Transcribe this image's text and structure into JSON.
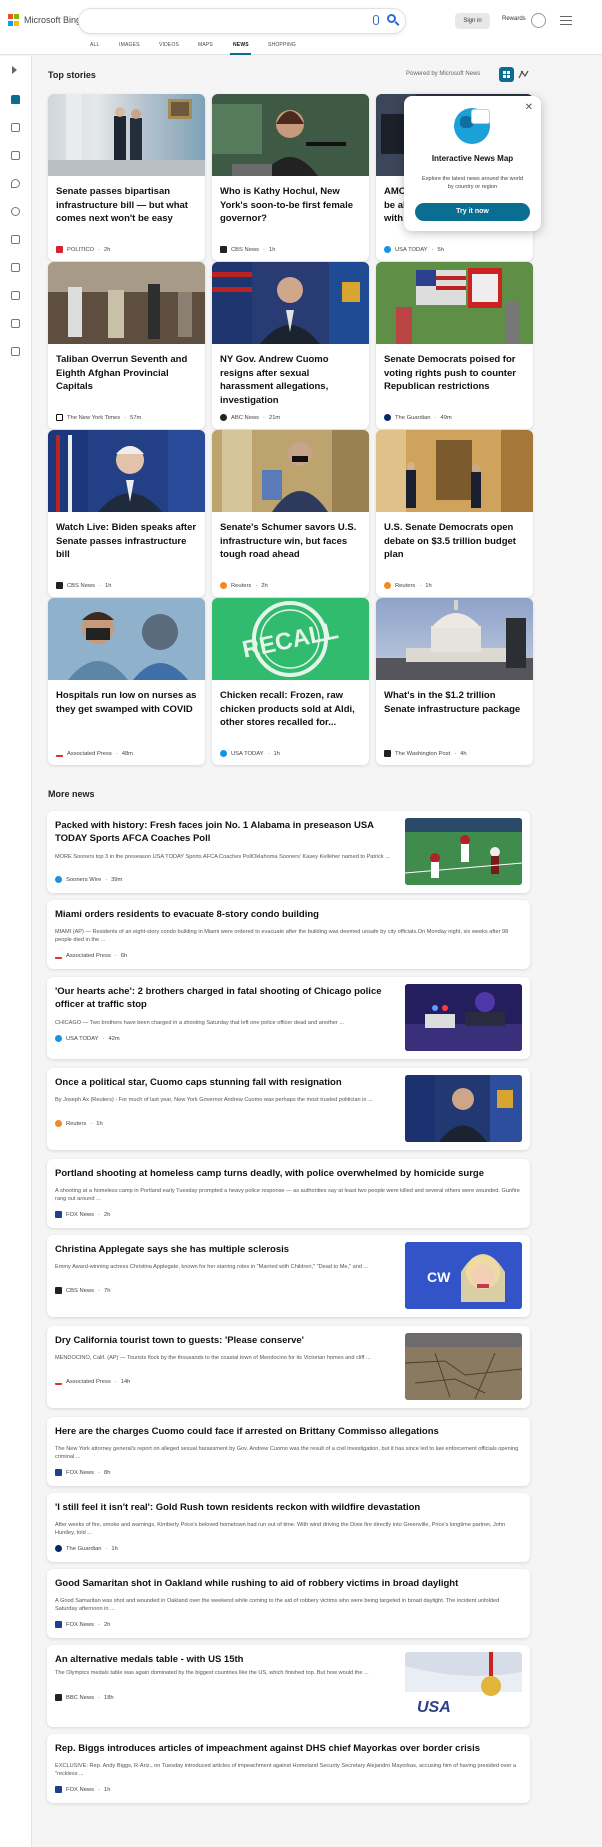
{
  "header": {
    "logo_text": "Microsoft Bing",
    "sign_in": "Sign in",
    "rewards": "Rewards",
    "tabs": [
      "ALL",
      "IMAGES",
      "VIDEOS",
      "MAPS",
      "NEWS",
      "SHOPPING"
    ],
    "active_tab": "NEWS"
  },
  "top_stories": {
    "heading": "Top stories",
    "powered_by": "Powered by Microsoft News",
    "cards": [
      {
        "title": "Senate passes bipartisan infrastructure bill — but what comes next won't be easy",
        "source": "POLITICO",
        "time": "2h",
        "source_color": "#d6232f"
      },
      {
        "title": "Who is Kathy Hochul, New York's soon-to-be first female governor?",
        "source": "CBS News",
        "time": "1h",
        "source_color": "#222222"
      },
      {
        "title": "AMC be al with",
        "source": "USA TODAY",
        "time": "5h",
        "source_color": "#1a90e8"
      },
      {
        "title": "Taliban Overrun Seventh and Eighth Afghan Provincial Capitals",
        "source": "The New York Times",
        "time": "57m",
        "source_color": "#111111"
      },
      {
        "title": "NY Gov. Andrew Cuomo resigns after sexual harassment allegations, investigation",
        "source": "ABC News",
        "time": "21m",
        "source_color": "#222222"
      },
      {
        "title": "Senate Democrats poised for voting rights push to counter Republican restrictions",
        "source": "The Guardian",
        "time": "49m",
        "source_color": "#052962"
      },
      {
        "title": "Watch Live: Biden speaks after Senate passes infrastructure bill",
        "source": "CBS News",
        "time": "1h",
        "source_color": "#222222"
      },
      {
        "title": "Senate's Schumer savors U.S. infrastructure win, but faces tough road ahead",
        "source": "Reuters",
        "time": "2h",
        "source_color": "#f08a24"
      },
      {
        "title": "U.S. Senate Democrats open debate on $3.5 trillion budget plan",
        "source": "Reuters",
        "time": "1h",
        "source_color": "#f08a24"
      },
      {
        "title": "Hospitals run low on nurses as they get swamped with COVID",
        "source": "Associated Press",
        "time": "48m",
        "source_color": "#e4312b"
      },
      {
        "title": "Chicken recall: Frozen, raw chicken products sold at Aldi, other stores recalled for...",
        "source": "USA TODAY",
        "time": "1h",
        "source_color": "#1a90e8"
      },
      {
        "title": "What's in the $1.2 trillion Senate infrastructure package",
        "source": "The Washington Post",
        "time": "4h",
        "source_color": "#222222"
      }
    ]
  },
  "popup": {
    "title": "Interactive News Map",
    "description": "Explore the latest news around the world by country or region",
    "button": "Try it now",
    "close": "✕"
  },
  "recall_image_text": "RECALL",
  "more_news": {
    "heading": "More news",
    "items": [
      {
        "title": "Packed with history: Fresh faces join No. 1 Alabama in preseason USA TODAY Sports AFCA Coaches Poll",
        "desc": "MORE Sooners top 3 in the preseason USA TODAY Sports AFCA Coaches PollOklahoma Sooners' Kasey Kelleher named to Patrick ...",
        "source": "Sooners Wire",
        "time": "39m",
        "source_color": "#1a90e8"
      },
      {
        "title": "Miami orders residents to evacuate 8-story condo building",
        "desc": "MIAMI (AP) — Residents of an eight-story condo building in Miami were ordered to evacuate after the building was deemed unsafe by city officials.On Monday night, six weeks after 98 people died in the ...",
        "source": "Associated Press",
        "time": "6h",
        "source_color": "#e4312b"
      },
      {
        "title": "'Our hearts ache': 2 brothers charged in fatal shooting of Chicago police officer at traffic stop",
        "desc": "CHICAGO — Two brothers have been charged in a shooting Saturday that left one police officer dead and another ...",
        "source": "USA TODAY",
        "time": "42m",
        "source_color": "#1a90e8"
      },
      {
        "title": "Once a political star, Cuomo caps stunning fall with resignation",
        "desc": "By Joseph Ax (Reuters) - For much of last year, New York Governor Andrew Cuomo was perhaps the most trusted politician in ...",
        "source": "Reuters",
        "time": "1h",
        "source_color": "#f08a24"
      },
      {
        "title": "Portland shooting at homeless camp turns deadly, with police overwhelmed by homicide surge",
        "desc": "A shooting at a homeless camp in Portland early Tuesday prompted a heavy police response — as authorities say at least two people were killed and several others were wounded. Gunfire rang out around ...",
        "source": "FOX News",
        "time": "2h",
        "source_color": "#1d3f8f"
      },
      {
        "title": "Christina Applegate says she has multiple sclerosis",
        "desc": "Emmy Award-winning actress Christina Applegate, known for her starring roles in \"Married with Children,\" \"Dead to Me,\" and ...",
        "source": "CBS News",
        "time": "7h",
        "source_color": "#222222"
      },
      {
        "title": "Dry California tourist town to guests: 'Please conserve'",
        "desc": "MENDOCINO, Calif. (AP) — Tourists flock by the thousands to the coastal town of Mendocino for its Victorian homes and cliff ...",
        "source": "Associated Press",
        "time": "14h",
        "source_color": "#e4312b"
      },
      {
        "title": "Here are the charges Cuomo could face if arrested on Brittany Commisso allegations",
        "desc": "The New York attorney general's report on alleged sexual harassment by Gov. Andrew Cuomo was the result of a civil investigation, but it has since led to law enforcement officials opening criminal ...",
        "source": "FOX News",
        "time": "8h",
        "source_color": "#1d3f8f"
      },
      {
        "title": "'I still feel it isn't real': Gold Rush town residents reckon with wildfire devastation",
        "desc": "After weeks of fire, smoke and warnings, Kimberly Price's beloved hometown had run out of time. With wind driving the Dixie fire directly into Greenville, Price's longtime partner, John Huntley, told ...",
        "source": "The Guardian",
        "time": "1h",
        "source_color": "#052962"
      },
      {
        "title": "Good Samaritan shot in Oakland while rushing to aid of robbery victims in broad daylight",
        "desc": "A Good Samaritan was shot and wounded in Oakland over the weekend while coming to the aid of robbery victims who were being targeted in broad daylight. The incident unfolded Saturday afternoon in ...",
        "source": "FOX News",
        "time": "2h",
        "source_color": "#1d3f8f"
      },
      {
        "title": "An alternative medals table - with US 15th",
        "desc": "The Olympics medals table was again dominated by the biggest countries like the US, which finished top. But how would the ...",
        "source": "BBC News",
        "time": "18h",
        "source_color": "#222222"
      },
      {
        "title": "Rep. Biggs introduces articles of impeachment against DHS chief Mayorkas over border crisis",
        "desc": "EXCLUSIVE: Rep. Andy Biggs, R-Ariz., on Tuesday introduced articles of impeachment against Homeland Security Secretary Alejandro Mayorkas, accusing him of having presided over a \"reckless ...",
        "source": "FOX News",
        "time": "1h",
        "source_color": "#1d3f8f"
      }
    ]
  },
  "more_news_images": {
    "applegate_badge": "CW"
  }
}
